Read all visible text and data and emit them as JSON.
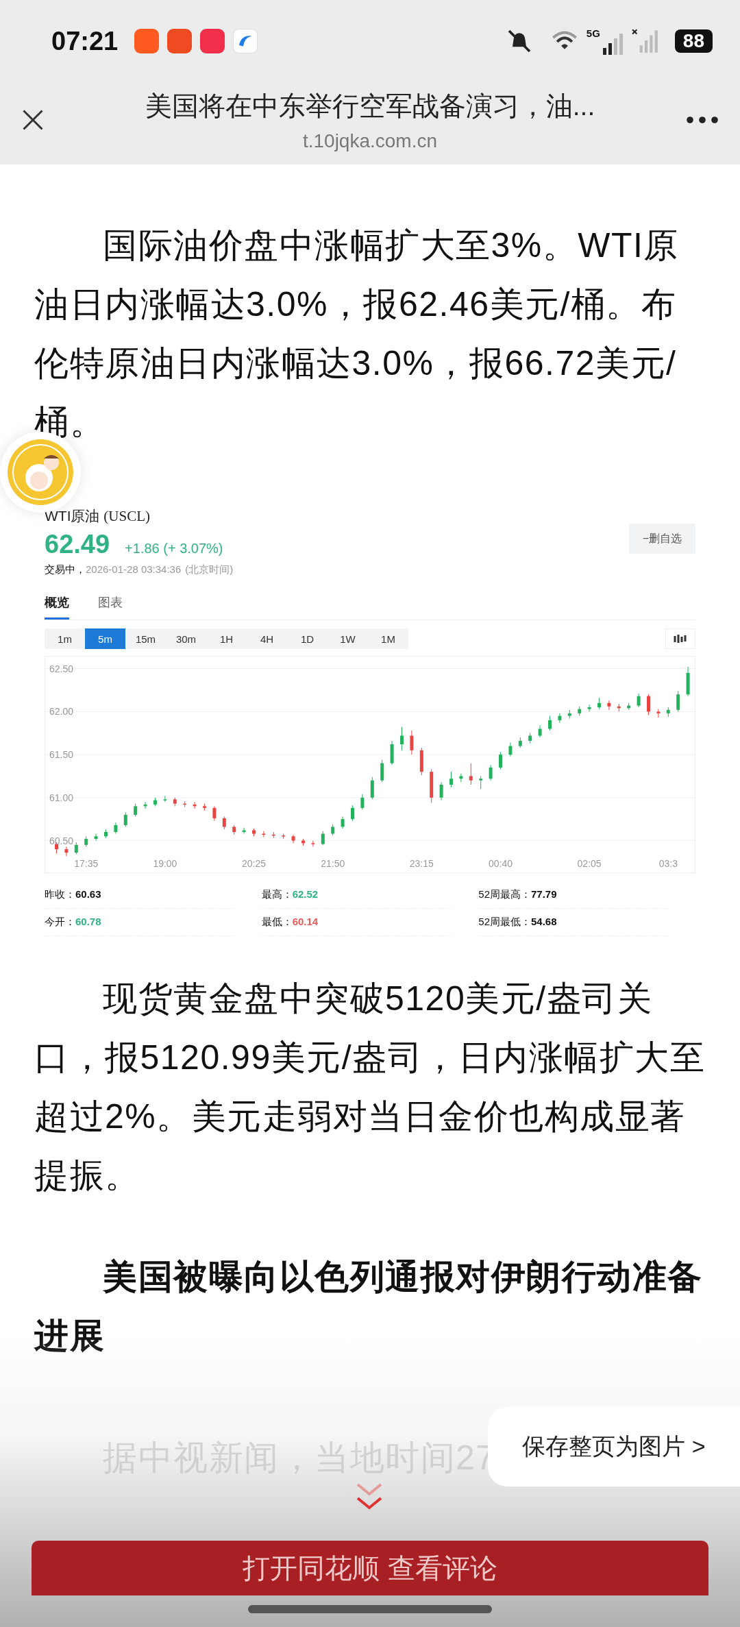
{
  "status_bar": {
    "time": "07:21",
    "battery": "88",
    "network": "5G"
  },
  "header": {
    "title": "美国将在中东举行空军战备演习，油...",
    "domain": "t.10jqka.com.cn"
  },
  "paragraphs": [
    {
      "kind": "body",
      "text": "国际油价盘中涨幅扩大至3%。WTI原油日内涨幅达3.0%，报62.46美元/桶。布伦特原油日内涨幅达3.0%，报66.72美元/桶。"
    }
  ],
  "quote": {
    "name": "WTI原油",
    "code": "(USCL)",
    "price": "62.49",
    "change": "+1.86 (+ 3.07%)",
    "status": "交易中，",
    "datetime": "2026-01-28 03:34:36",
    "timezone": "(北京时间)",
    "watch_button": "−删自选",
    "tabs": [
      {
        "label": "概览",
        "selected": true
      },
      {
        "label": "图表",
        "selected": false
      }
    ],
    "periods": [
      {
        "label": "1m",
        "selected": false
      },
      {
        "label": "5m",
        "selected": true
      },
      {
        "label": "15m",
        "selected": false
      },
      {
        "label": "30m",
        "selected": false
      },
      {
        "label": "1H",
        "selected": false
      },
      {
        "label": "4H",
        "selected": false
      },
      {
        "label": "1D",
        "selected": false
      },
      {
        "label": "1W",
        "selected": false
      },
      {
        "label": "1M",
        "selected": false
      }
    ],
    "chart_data": {
      "type": "candlestick",
      "grid": true,
      "ylim": [
        60.13,
        62.64
      ],
      "yticks": [
        {
          "value": 62.5,
          "label": "62.50"
        },
        {
          "value": 62,
          "label": "62.00"
        },
        {
          "value": 61.5,
          "label": "61.50"
        },
        {
          "value": 61,
          "label": "61.00"
        },
        {
          "value": 60.5,
          "label": "60.50"
        }
      ],
      "categories": [
        null,
        null,
        null,
        "17:35",
        null,
        null,
        null,
        null,
        null,
        null,
        null,
        "19:00",
        null,
        null,
        null,
        null,
        null,
        null,
        null,
        null,
        "20:25",
        null,
        null,
        null,
        null,
        null,
        null,
        null,
        "21:50",
        null,
        null,
        null,
        null,
        null,
        null,
        null,
        null,
        "23:15",
        null,
        null,
        null,
        null,
        null,
        null,
        null,
        "00:40",
        null,
        null,
        null,
        null,
        null,
        null,
        null,
        null,
        "02:05",
        null,
        null,
        null,
        null,
        null,
        null,
        null,
        "03:3",
        null,
        null
      ],
      "ohlc": [
        [
          60.46,
          60.48,
          60.35,
          60.4
        ],
        [
          60.4,
          60.43,
          60.32,
          60.36
        ],
        [
          60.36,
          60.48,
          60.34,
          60.45
        ],
        [
          60.45,
          60.55,
          60.43,
          60.52
        ],
        [
          60.52,
          60.58,
          60.5,
          60.55
        ],
        [
          60.55,
          60.63,
          60.53,
          60.6
        ],
        [
          60.6,
          60.71,
          60.58,
          60.68
        ],
        [
          60.68,
          60.83,
          60.66,
          60.8
        ],
        [
          60.8,
          60.93,
          60.78,
          60.9
        ],
        [
          60.9,
          60.95,
          60.87,
          60.92
        ],
        [
          60.92,
          61.0,
          60.9,
          60.97
        ],
        [
          60.97,
          61.02,
          60.95,
          60.98
        ],
        [
          60.98,
          61.0,
          60.9,
          60.93
        ],
        [
          60.93,
          60.96,
          60.89,
          60.92
        ],
        [
          60.92,
          60.95,
          60.87,
          60.9
        ],
        [
          60.9,
          60.93,
          60.85,
          60.88
        ],
        [
          60.88,
          60.9,
          60.73,
          60.76
        ],
        [
          60.76,
          60.78,
          60.63,
          60.66
        ],
        [
          60.66,
          60.68,
          60.57,
          60.6
        ],
        [
          60.6,
          60.65,
          60.58,
          60.62
        ],
        [
          60.62,
          60.64,
          60.55,
          60.58
        ],
        [
          60.58,
          60.61,
          60.54,
          60.57
        ],
        [
          60.57,
          60.6,
          60.53,
          60.56
        ],
        [
          60.56,
          60.58,
          60.52,
          60.55
        ],
        [
          60.55,
          60.57,
          60.47,
          60.5
        ],
        [
          60.5,
          60.52,
          60.44,
          60.47
        ],
        [
          60.47,
          60.5,
          60.43,
          60.46
        ],
        [
          60.46,
          60.61,
          60.45,
          60.58
        ],
        [
          60.58,
          60.69,
          60.56,
          60.66
        ],
        [
          60.66,
          60.78,
          60.64,
          60.75
        ],
        [
          60.75,
          60.91,
          60.73,
          60.88
        ],
        [
          60.88,
          61.04,
          60.86,
          61.0
        ],
        [
          61.0,
          61.24,
          60.98,
          61.2
        ],
        [
          61.2,
          61.44,
          61.18,
          61.4
        ],
        [
          61.4,
          61.66,
          61.38,
          61.62
        ],
        [
          61.62,
          61.82,
          61.55,
          61.72
        ],
        [
          61.72,
          61.78,
          61.5,
          61.55
        ],
        [
          61.55,
          61.58,
          61.26,
          61.3
        ],
        [
          61.3,
          61.33,
          60.94,
          61.0
        ],
        [
          61.0,
          61.18,
          60.97,
          61.15
        ],
        [
          61.15,
          61.3,
          61.12,
          61.22
        ],
        [
          61.22,
          61.28,
          61.18,
          61.25
        ],
        [
          61.25,
          61.4,
          61.15,
          61.2
        ],
        [
          61.2,
          61.25,
          61.1,
          61.22
        ],
        [
          61.22,
          61.38,
          61.2,
          61.35
        ],
        [
          61.35,
          61.53,
          61.33,
          61.5
        ],
        [
          61.5,
          61.64,
          61.48,
          61.6
        ],
        [
          61.6,
          61.7,
          61.58,
          61.66
        ],
        [
          61.66,
          61.75,
          61.63,
          61.72
        ],
        [
          61.72,
          61.84,
          61.7,
          61.8
        ],
        [
          61.8,
          61.95,
          61.78,
          61.9
        ],
        [
          61.9,
          61.98,
          61.87,
          61.95
        ],
        [
          61.95,
          62.02,
          61.92,
          61.98
        ],
        [
          61.98,
          62.06,
          61.95,
          62.03
        ],
        [
          62.03,
          62.08,
          62.0,
          62.05
        ],
        [
          62.05,
          62.16,
          62.03,
          62.1
        ],
        [
          62.1,
          62.13,
          62.02,
          62.06
        ],
        [
          62.06,
          62.09,
          62.0,
          62.04
        ],
        [
          62.04,
          62.1,
          62.02,
          62.07
        ],
        [
          62.07,
          62.21,
          62.05,
          62.18
        ],
        [
          62.18,
          62.2,
          61.96,
          62.0
        ],
        [
          62.0,
          62.03,
          61.93,
          61.98
        ],
        [
          61.98,
          62.05,
          61.94,
          62.02
        ],
        [
          62.02,
          62.24,
          62.0,
          62.2
        ],
        [
          62.2,
          62.52,
          62.18,
          62.45
        ]
      ]
    },
    "stats": [
      {
        "label": "昨收：",
        "value": "60.63",
        "color": "#111111"
      },
      {
        "label": "最高：",
        "value": "62.52",
        "color": "#2fb383"
      },
      {
        "label": "52周最高：",
        "value": "77.79",
        "color": "#111111"
      },
      {
        "label": "今开：",
        "value": "60.78",
        "color": "#2fb383"
      },
      {
        "label": "最低：",
        "value": "60.14",
        "color": "#e85a5a"
      },
      {
        "label": "52周最低：",
        "value": "54.68",
        "color": "#111111"
      }
    ]
  },
  "paragraphs_after": [
    {
      "kind": "body",
      "text": "现货黄金盘中突破5120美元/盎司关口，报5120.99美元/盎司，日内涨幅扩大至超过2%。美元走弱对当日金价也构成显著提振。"
    },
    {
      "kind": "heading",
      "text": "美国被曝向以色列通报对伊朗行动准备进展"
    },
    {
      "kind": "faded",
      "text": "据中视新闻，当地时间27"
    }
  ],
  "save_button": "保存整页为图片 >",
  "open_app_button": "打开同花顺 查看评论"
}
